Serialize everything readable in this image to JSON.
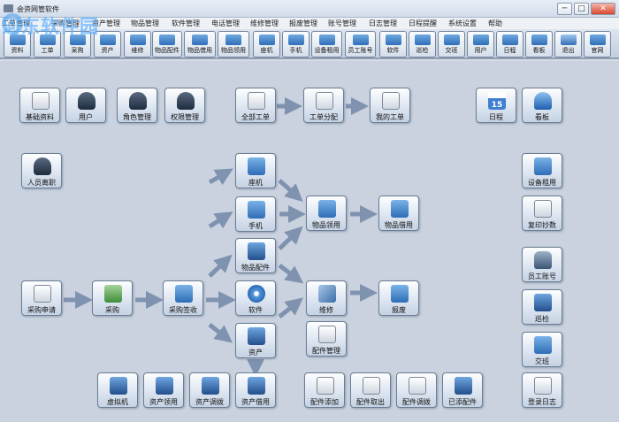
{
  "window": {
    "title": "会资网管软件",
    "minimize": "─",
    "maximize": "□",
    "close": "✕"
  },
  "watermark": "河东软件园",
  "menu": [
    "工单管理",
    "采购管理",
    "资产管理",
    "物品管理",
    "软件管理",
    "电话管理",
    "维修管理",
    "报废管理",
    "账号管理",
    "日志管理",
    "日程提醒",
    "系统设置",
    "帮助"
  ],
  "toolbar": [
    {
      "label": "资料",
      "icon": "gear-icon"
    },
    {
      "label": "工单",
      "icon": "document-icon"
    },
    {
      "label": "采购",
      "icon": "cart-icon"
    },
    {
      "label": "资产",
      "icon": "computer-icon"
    },
    {
      "label": "维修",
      "icon": "tools-icon"
    },
    {
      "label": "物品配件",
      "icon": "parts-icon"
    },
    {
      "label": "物品借用",
      "icon": "borrow-icon"
    },
    {
      "label": "物品领用",
      "icon": "receive-icon"
    },
    {
      "label": "座机",
      "icon": "phone-icon"
    },
    {
      "label": "手机",
      "icon": "mobile-icon"
    },
    {
      "label": "设备租用",
      "icon": "printer-icon"
    },
    {
      "label": "员工账号",
      "icon": "lock-icon"
    },
    {
      "label": "软件",
      "icon": "disc-icon"
    },
    {
      "label": "巡检",
      "icon": "network-icon"
    },
    {
      "label": "交班",
      "icon": "handover-icon"
    },
    {
      "label": "用户",
      "icon": "user-icon"
    },
    {
      "label": "日程",
      "icon": "calendar-icon"
    },
    {
      "label": "看板",
      "icon": "bell-icon"
    },
    {
      "label": "退出",
      "icon": "close-icon"
    },
    {
      "label": "官网",
      "icon": "home-icon"
    }
  ],
  "nodes": {
    "basic_info": "基础资料",
    "user": "用户",
    "role_mgmt": "角色管理",
    "permission_mgmt": "权限管理",
    "all_workorders": "全部工单",
    "workorder_assign": "工单分配",
    "my_workorders": "我的工单",
    "schedule": "日程",
    "calendar_day": "15",
    "dashboard": "看板",
    "staff_leave": "人员离职",
    "landline": "座机",
    "mobile": "手机",
    "parts": "物品配件",
    "software": "软件",
    "assets": "资产",
    "item_receive": "物品领用",
    "item_borrow": "物品借用",
    "purchase_request": "采购申请",
    "purchase": "采购",
    "purchase_sign": "采购签收",
    "repair": "维修",
    "scrap": "报废",
    "parts_mgmt": "配件管理",
    "equipment_rent": "设备租用",
    "print_copy": "复印抄数",
    "staff_account": "员工账号",
    "inspection": "巡检",
    "shift_handover": "交班",
    "login_log": "登录日志",
    "virtual_machine": "虚拟机",
    "asset_receive": "资产领用",
    "asset_transfer": "资产调拨",
    "asset_borrow": "资产借用",
    "parts_add": "配件添加",
    "parts_out": "配件取出",
    "parts_transfer": "配件调拨",
    "scrapped_parts": "已添配件"
  }
}
